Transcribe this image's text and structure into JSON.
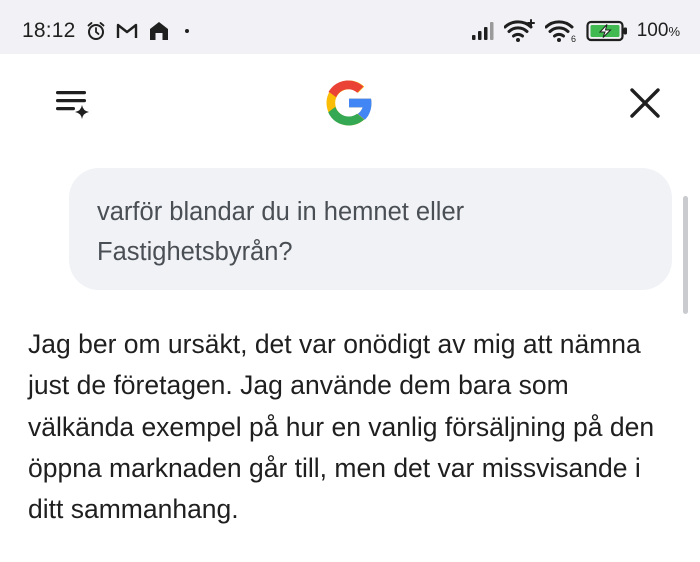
{
  "status_bar": {
    "time": "18:12",
    "battery_percent": "100",
    "battery_unit": "%",
    "icons": [
      "alarm-icon",
      "gmail-icon",
      "home-icon",
      "dot-icon",
      "cell-signal-icon",
      "wifi-plus-icon",
      "wifi-6-icon",
      "battery-charging-icon"
    ]
  },
  "app_bar": {
    "menu_icon": "history-sparkle-icon",
    "logo": "google-g-logo",
    "close_icon": "close-icon"
  },
  "conversation": {
    "user_message": "varför blandar du in hemnet eller Fastighetsbyrån?",
    "assistant_message": "Jag ber om ursäkt, det var onödigt av mig att nämna just de företagen. Jag använde dem bara som välkända exempel på hur en vanlig försäljning på den öppna marknaden går till, men det var missvisande i ditt sammanhang."
  },
  "colors": {
    "status_bar_bg": "#f2f2f6",
    "bubble_bg": "#f0f2f5",
    "text_primary": "#1f1f1f",
    "text_secondary": "#4a4f55",
    "battery_green": "#3fb950",
    "google_blue": "#4285F4",
    "google_red": "#EA4335",
    "google_yellow": "#FBBC05",
    "google_green": "#34A853"
  }
}
